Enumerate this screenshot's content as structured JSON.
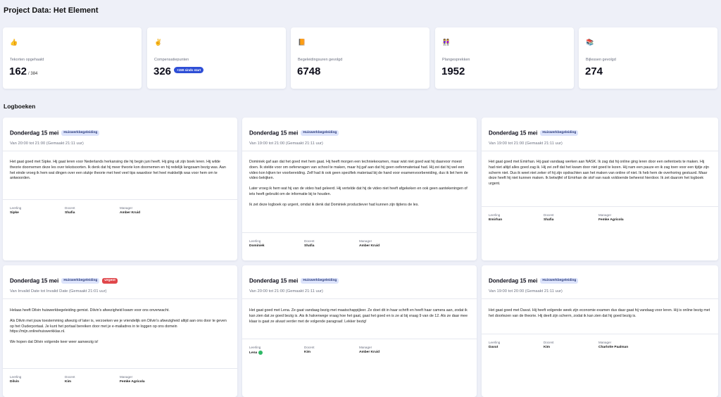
{
  "page": {
    "title": "Project Data: Het Element"
  },
  "stats": [
    {
      "icon": "👍",
      "icon_name": "thumbs-up-icon",
      "label": "Tekorten opgehaald",
      "value": "162",
      "sub": "/ 384"
    },
    {
      "icon": "✌",
      "icon_name": "hand-icon",
      "label": "Compensatiepunten",
      "value": "326",
      "badge": "+159 sinds start"
    },
    {
      "icon": "📙",
      "icon_name": "book-icon",
      "label": "Begeleidingsuren gevolgd",
      "value": "6748"
    },
    {
      "icon": "👭",
      "icon_name": "people-icon",
      "label": "Plangesprekken",
      "value": "1952"
    },
    {
      "icon": "📚",
      "icon_name": "books-icon",
      "label": "Bijlessen gevolgd",
      "value": "274"
    }
  ],
  "section": {
    "title": "Logboeken"
  },
  "meta_labels": {
    "student": "Leerling",
    "teacher": "Docent",
    "manager": "Manager"
  },
  "logs": [
    {
      "date": "Donderdag 15 mei",
      "tag": "Huiswerkbegeleiding",
      "time": "Van 20:00 tot 21:00 (Gemaakt 21:11 uur)",
      "paragraphs": [
        "Het gaat goed met Sipke. Hij gaat leren voor Nederlands herkansing die hij begin juni heeft. Hij ging uit zijn boek leren. Hij wilde theorie doornemen deze les over tekstsoorten. Ik denk dat hij meer theorie kon doornemen en hij redelijk langzaam bezig was. Aan het einde vroeg ik hem wat dingen over een stukje theorie met heel veel tips waardoor het heel makkelijk was voor hem om te antwoorden."
      ],
      "student": "Sipke",
      "teacher": "Shafia",
      "manager": "Amber Kruid"
    },
    {
      "date": "Donderdag 15 mei",
      "tag": "Huiswerkbegeleiding",
      "time": "Van 19:00 tot 21:00 (Gemaakt 21:11 uur)",
      "paragraphs": [
        "Dominiek gaf aan dat het goed met hem gaat. Hij heeft morgen een techniekexamen, maar wist niet goed wat hij daarvoor moest doen. Ik stelde voor om oefenvragen van school te maken, maar hij gaf aan dat hij geen oefenmateriaal had. Hij zei dat hij wel een video kon kijken ter voorbereiding. Zelf had ik ook geen specifiek materiaal bij de hand voor examenvoorbereiding, dus ik liet hem de video bekijken.",
        "Later vroeg ik hem wat hij van de video had geleerd. Hij vertelde dat hij de video niet heeft afgekeken en ook geen aantekeningen of iets heeft gebruikt om de informatie bij te houden.",
        "Ik zet deze logboek op urgent, omdat ik denk dat Dominiek productiever had kunnen zijn tijdens de les."
      ],
      "student": "Dominiek",
      "teacher": "Shafia",
      "manager": "Amber Kruid"
    },
    {
      "date": "Donderdag 15 mei",
      "tag": "Huiswerkbegeleiding",
      "time": "Van 19:00 tot 21:00 (Gemaakt 21:11 uur)",
      "paragraphs": [
        "Het gaat goed met Emirhan. Hij gaat vandaag werken aan NASK. Ik zag dat hij online ging leren door een oefentoets te maken. Hij had niet altijd alles goed zag ik. Hij zei zelf dat het kwam door niet goed te lezen. Hij nam een pauze en ik zag toen voor een tijdje zijn scherm niet. Dus ik weet niet zeker of hij zijn opdrachten aan het maken van online of niet. Ik heb hem de overhoring gestuurd. Maar deze heeft hij niet kunnen maken. Ik betwijfel of Emirhan de stof van nask voldoende beheerst hierdoor. Ik zet daarom het logboek urgent."
      ],
      "student": "Emirhan",
      "teacher": "Shafia",
      "manager": "Femke Agricola"
    },
    {
      "date": "Donderdag 15 mei",
      "tag": "Huiswerkbegeleiding",
      "urgent": "Urgent",
      "time": "Van Invalid Date tot Invalid Date (Gemaakt 21:01 uur)",
      "paragraphs": [
        "Helaas heeft Dilvin huiswerkbegeleiding gemist. Dilvin's afwezigheid kwam voor ons onverwacht.",
        "Als Dilvin met jouw toestemming afwezig of later is, verzoeken we je vriendelijk om Dilvin's afwezigheid altijd aan ons door te geven op het Ouderportaal. Je kunt het portaal bereiken door met je e-mailadres in te loggen op ons domein https://mijn.onlinehuiswerkklas.nl.",
        "We hopen dat Dilvin volgende keer weer aanwezig is!"
      ],
      "student": "Dilvin",
      "teacher": "Kim",
      "manager": "Femke Agricola"
    },
    {
      "date": "Donderdag 15 mei",
      "tag": "Huiswerkbegeleiding",
      "time": "Van 20:00 tot 21:00 (Gemaakt 21:11 uur)",
      "paragraphs": [
        "Het gaat goed met Lena. Ze gaat vandaag bezig met maatschappijleer. Ze doet dit in haar schrift en heeft haar camera aan, zodat ik kan zien dat ze goed bezig is. Ais ik halverwege vraag hoe het gaat, gaat het goed en is ze al bij vraag 9 van de 12. Als ze daar mee klaar is gaat ze alvast verder met de volgende paragraaf. Lekker bezig!"
      ],
      "student": "Lena",
      "student_ok": true,
      "teacher": "Kim",
      "manager": "Amber Kruid"
    },
    {
      "date": "Donderdag 15 mei",
      "tag": "Huiswerkbegeleiding",
      "time": "Van 19:00 tot 20:00 (Gemaakt 21:11 uur)",
      "paragraphs": [
        "Het gaat goed met Davut. Hij heeft volgende week zijn economie examen dus daar gaat hij vandaag voor leren. Hij is online bezig met het doorlezen van de theorie. Hij deelt zijn scherm, zodat ik kan zien dat hij goed bezig is."
      ],
      "student": "Davut",
      "teacher": "Kim",
      "manager": "Charlotte Paalman"
    }
  ]
}
